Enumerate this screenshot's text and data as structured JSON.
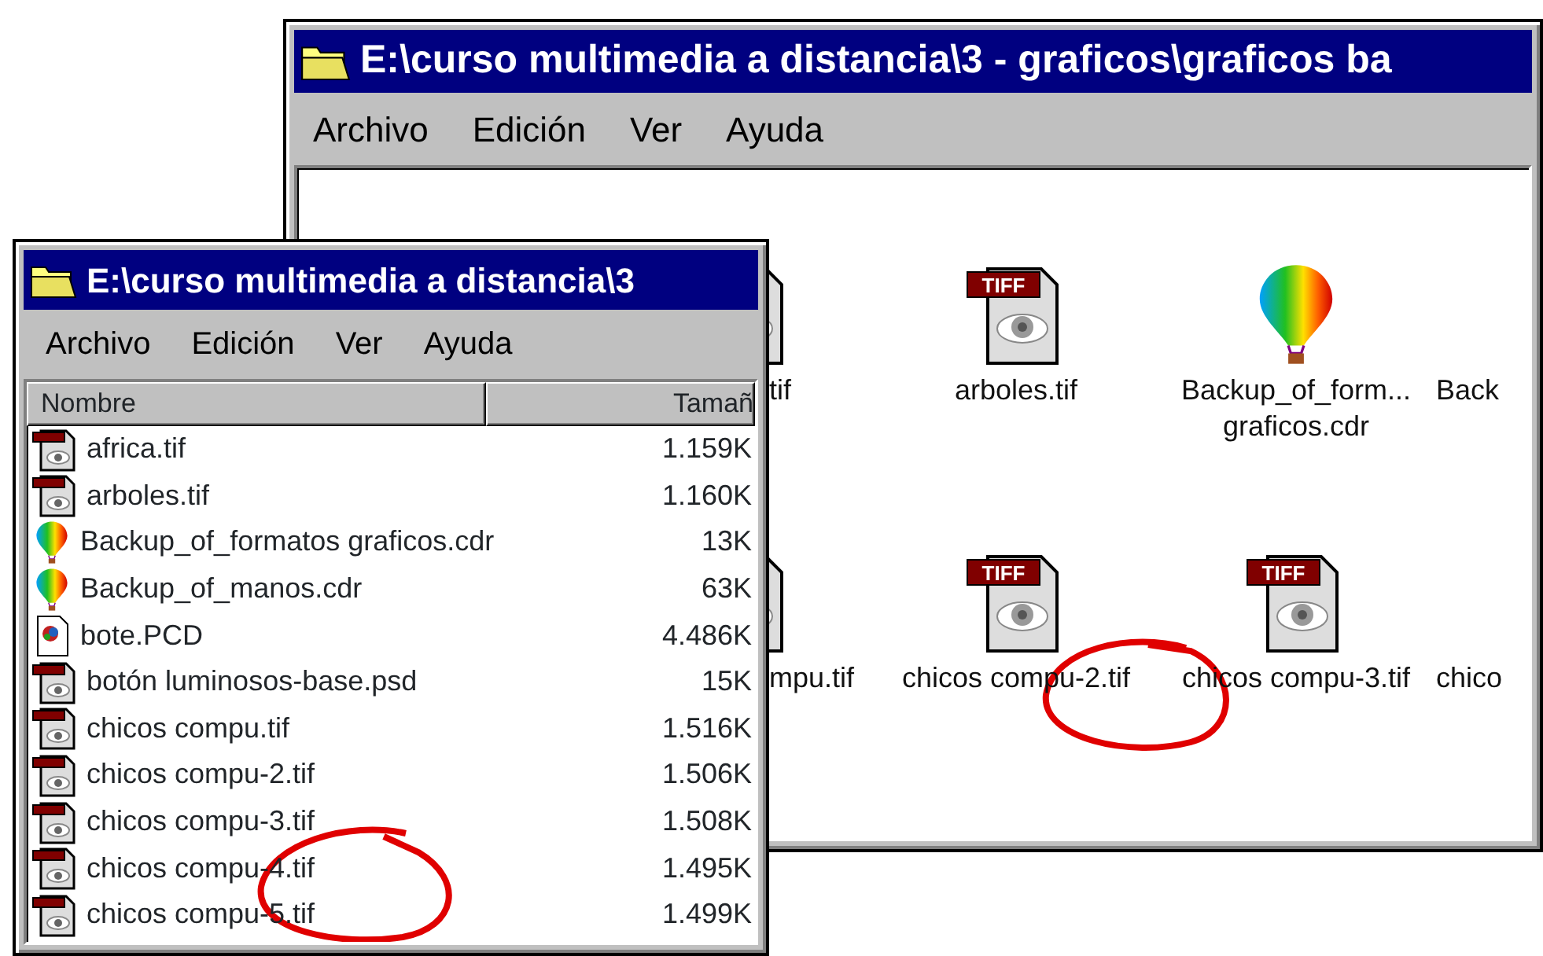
{
  "back_window": {
    "title": "E:\\curso multimedia a distancia\\3 - graficos\\graficos ba",
    "menu": [
      "Archivo",
      "Edición",
      "Ver",
      "Ayuda"
    ],
    "icons": [
      {
        "label": "tif",
        "kind": "tiff"
      },
      {
        "label": "arboles.tif",
        "kind": "tiff",
        "badge": "TIFF"
      },
      {
        "label": "Backup_of_form... graficos.cdr",
        "kind": "corel"
      },
      {
        "label": "Back",
        "kind": "none"
      },
      {
        "label": "mpu.tif",
        "kind": "tiff"
      },
      {
        "label": "chicos compu-2.tif",
        "kind": "tiff",
        "badge": "TIFF"
      },
      {
        "label": "chicos compu-3.tif",
        "kind": "tiff",
        "badge": "TIFF"
      },
      {
        "label": "chico",
        "kind": "none"
      }
    ]
  },
  "front_window": {
    "title": "E:\\curso multimedia a distancia\\3",
    "menu": [
      "Archivo",
      "Edición",
      "Ver",
      "Ayuda"
    ],
    "columns": [
      "Nombre",
      "Tamañ"
    ],
    "rows": [
      {
        "name": "africa.tif",
        "size": "1.159K",
        "kind": "image"
      },
      {
        "name": "arboles.tif",
        "size": "1.160K",
        "kind": "image"
      },
      {
        "name": "Backup_of_formatos graficos.cdr",
        "size": "13K",
        "kind": "corel"
      },
      {
        "name": "Backup_of_manos.cdr",
        "size": "63K",
        "kind": "corel"
      },
      {
        "name": "bote.PCD",
        "size": "4.486K",
        "kind": "pcd"
      },
      {
        "name": "botón luminosos-base.psd",
        "size": "15K",
        "kind": "image"
      },
      {
        "name": "chicos compu.tif",
        "size": "1.516K",
        "kind": "image"
      },
      {
        "name": "chicos compu-2.tif",
        "size": "1.506K",
        "kind": "image"
      },
      {
        "name": "chicos compu-3.tif",
        "size": "1.508K",
        "kind": "image"
      },
      {
        "name": "chicos compu-4.tif",
        "size": "1.495K",
        "kind": "image"
      },
      {
        "name": "chicos compu-5.tif",
        "size": "1.499K",
        "kind": "image"
      }
    ]
  }
}
